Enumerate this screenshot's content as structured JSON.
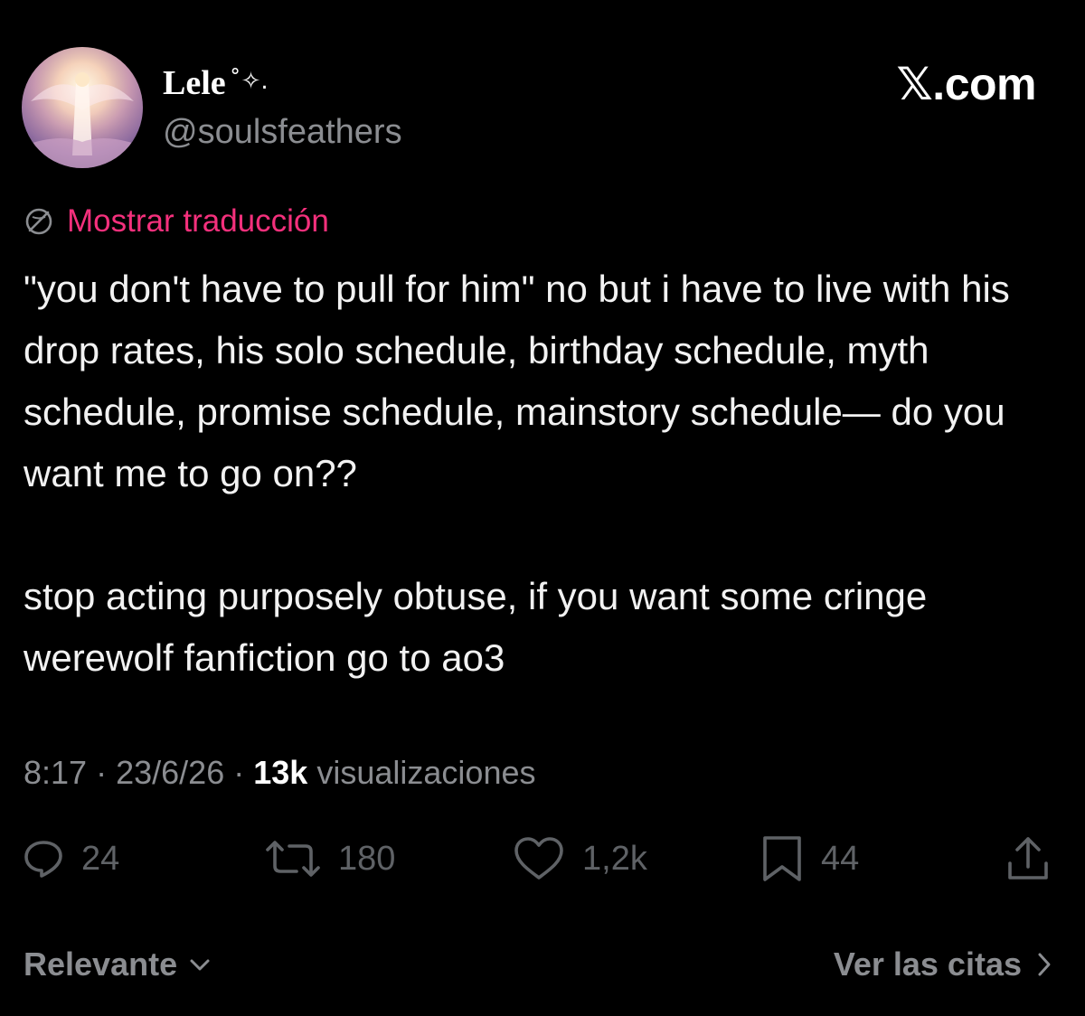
{
  "author": {
    "display_name": "Lele",
    "name_emoji": "˚✧.",
    "handle": "@soulsfeathers",
    "avatar_icon": "avatar-image"
  },
  "brand": {
    "label": "𝕏.com"
  },
  "translate": {
    "icon": "globe-translate-icon",
    "label": "Mostrar traducción",
    "color": "#f4307c"
  },
  "tweet": {
    "paragraphs": [
      "\"you don't have to pull for him\" no but i have to live with his drop rates, his solo schedule, birthday schedule, myth schedule, promise schedule, mainstory schedule— do you want me to go on??",
      "stop acting purposely obtuse, if you want some cringe werewolf fanfiction go to ao3"
    ]
  },
  "meta": {
    "time": "8:17",
    "separator": "·",
    "date": "23/6/26",
    "views_count": "13k",
    "views_label": "visualizaciones"
  },
  "actions": {
    "replies": {
      "count": "24",
      "icon": "reply-icon"
    },
    "reposts": {
      "count": "180",
      "icon": "repost-icon"
    },
    "likes": {
      "count": "1,2k",
      "icon": "heart-icon"
    },
    "bookmarks": {
      "count": "44",
      "icon": "bookmark-icon"
    },
    "share": {
      "icon": "share-icon"
    }
  },
  "footer": {
    "sort_label": "Relevante",
    "quotes_label": "Ver las citas"
  },
  "colors": {
    "background": "#000000",
    "text": "#f2f2f2",
    "muted": "#8b8d91",
    "action_muted": "#5f6266",
    "accent": "#f4307c"
  }
}
